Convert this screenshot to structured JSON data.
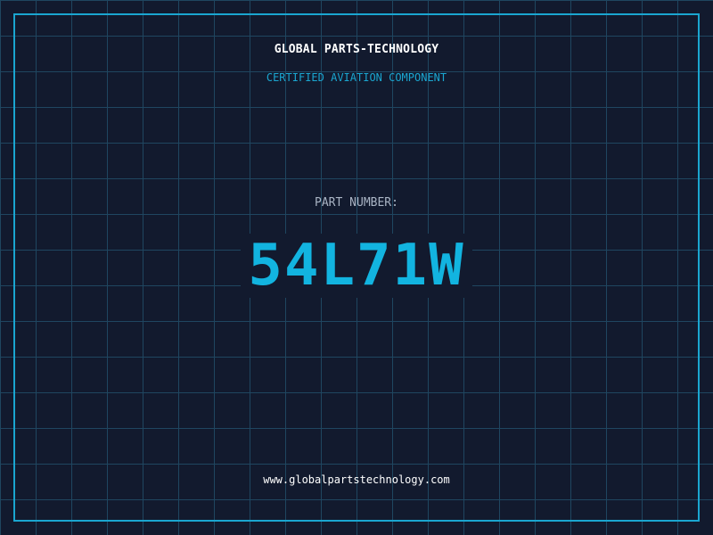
{
  "header": {
    "company_name": "GLOBAL PARTS-TECHNOLOGY",
    "tagline": "CERTIFIED AVIATION COMPONENT"
  },
  "part": {
    "label": "PART NUMBER:",
    "number": "54L71W"
  },
  "footer": {
    "website": "www.globalpartstechnology.com"
  },
  "colors": {
    "background": "#121a2e",
    "grid": "#1f4660",
    "accent": "#1aa6d0",
    "part_number": "#12b4e0",
    "label": "#a9b4c4",
    "text": "#ffffff"
  }
}
